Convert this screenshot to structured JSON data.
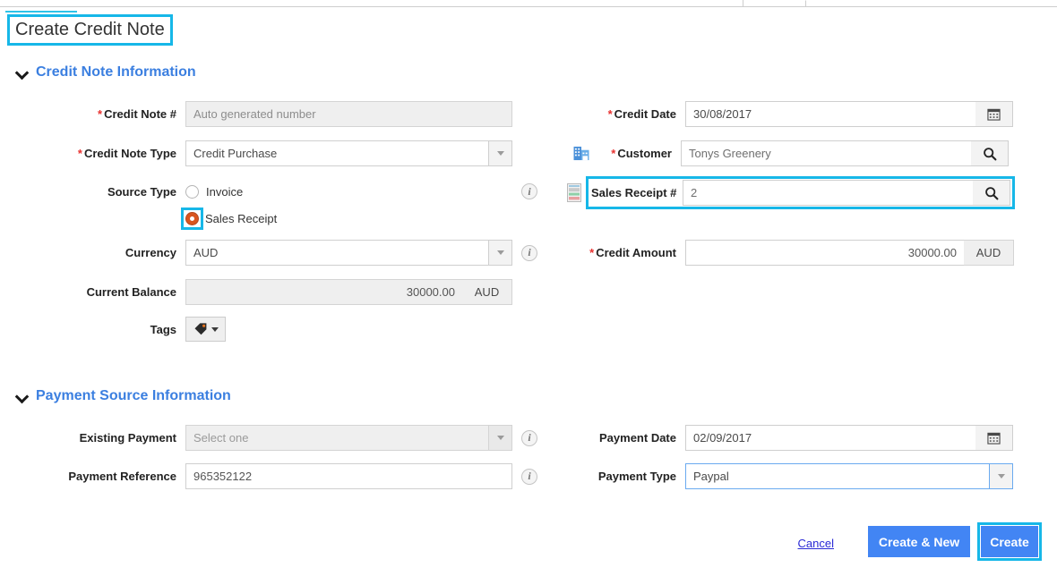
{
  "page": {
    "title": "Create Credit Note"
  },
  "sections": {
    "credit_note": {
      "title": "Credit Note Information",
      "fields": {
        "credit_note_number": {
          "label": "Credit Note #",
          "required": true,
          "value": "",
          "placeholder": "Auto generated number",
          "readonly": true
        },
        "credit_note_type": {
          "label": "Credit Note Type",
          "required": true,
          "value": "Credit Purchase"
        },
        "source_type": {
          "label": "Source Type",
          "options": [
            "Invoice",
            "Sales Receipt"
          ],
          "selected": "Sales Receipt"
        },
        "currency": {
          "label": "Currency",
          "value": "AUD"
        },
        "current_balance": {
          "label": "Current Balance",
          "value": "30000.00",
          "unit": "AUD",
          "readonly": true
        },
        "tags": {
          "label": "Tags",
          "icon": "tag-icon"
        },
        "credit_date": {
          "label": "Credit Date",
          "required": true,
          "value": "30/08/2017",
          "icon": "calendar-icon"
        },
        "customer": {
          "label": "Customer",
          "required": true,
          "value": "Tonys Greenery",
          "leading_icon": "building-icon",
          "icon": "search-icon"
        },
        "sales_receipt_number": {
          "label": "Sales Receipt #",
          "required": false,
          "value": "2",
          "leading_icon": "receipt-icon",
          "icon": "search-icon",
          "highlighted": true
        },
        "credit_amount": {
          "label": "Credit Amount",
          "required": true,
          "value": "30000.00",
          "unit": "AUD"
        }
      }
    },
    "payment_source": {
      "title": "Payment Source Information",
      "fields": {
        "existing_payment": {
          "label": "Existing Payment",
          "value": "",
          "placeholder": "Select one",
          "readonly": true
        },
        "payment_reference": {
          "label": "Payment Reference",
          "value": "965352122"
        },
        "payment_date": {
          "label": "Payment Date",
          "value": "02/09/2017",
          "icon": "calendar-icon"
        },
        "payment_type": {
          "label": "Payment Type",
          "value": "Paypal",
          "focused": true
        }
      }
    }
  },
  "footer": {
    "cancel_label": "Cancel",
    "create_new_label": "Create & New",
    "create_label": "Create"
  },
  "colors": {
    "highlight": "#16b7e8",
    "primary_button": "#4285f4",
    "section_title": "#3b7fe0",
    "required_star": "#e8312f",
    "radio_selected": "#d9551f",
    "link": "#2b2bd6"
  }
}
